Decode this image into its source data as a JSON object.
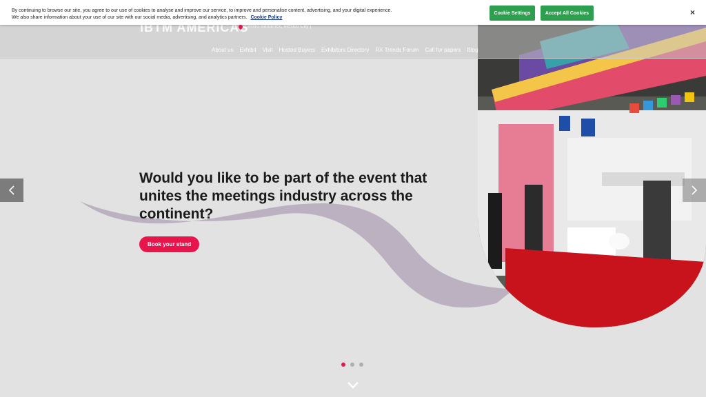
{
  "cookie_banner": {
    "text": "By continuing to browse our site, you agree to our use of cookies to analyse and improve our service, to improve and personalise content, advertising, and your digital experience. We also share information about your use of our site with our social media, advertising, and analytics partners.",
    "policy_link": "Cookie Policy",
    "settings_button": "Cookie Settings",
    "accept_button": "Accept All Cookies",
    "close": "×"
  },
  "header": {
    "logo": "IBTM AMERICAS",
    "location": "Centro Banamex, Mexico City |",
    "nav": [
      "About us",
      "Exhibit",
      "Visit",
      "Hosted Buyers",
      "Exhibitors Directory",
      "RX Trends Forum",
      "Call for papers",
      "Blog"
    ]
  },
  "hero": {
    "headline": "Would you like to be part of the event that unites the meetings industry across the continent?",
    "cta": "Book your stand",
    "slides_total": 3,
    "active_slide": 1
  },
  "colors": {
    "accent": "#e8154c",
    "cookie_button": "#2e9e4f"
  },
  "icons": {
    "prev": "chevron-left-icon",
    "next": "chevron-right-icon",
    "scroll": "chevron-down-icon",
    "location": "map-pin-icon"
  }
}
